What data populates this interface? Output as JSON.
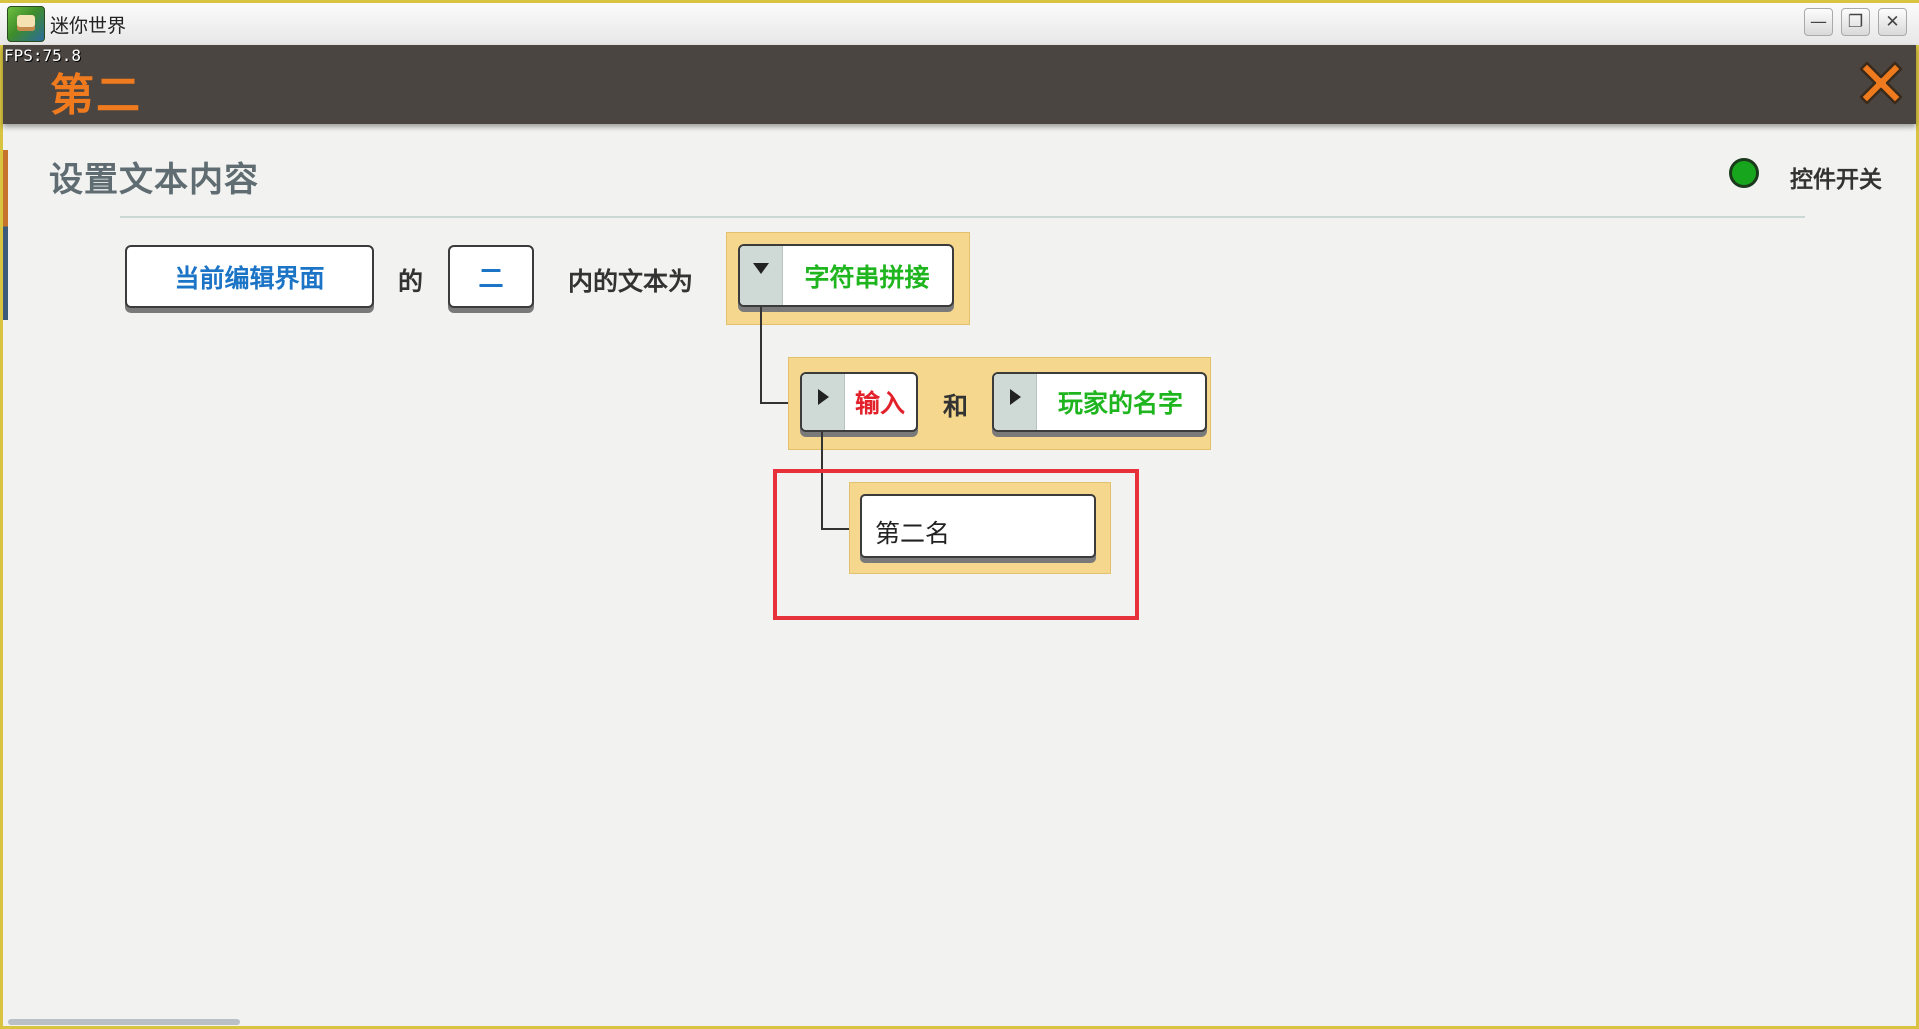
{
  "window": {
    "title": "迷你世界",
    "minimize_glyph": "—",
    "maximize_glyph": "❐",
    "close_glyph": "✕"
  },
  "fps": "FPS:75.8",
  "header": {
    "title": "第二"
  },
  "panel": {
    "heading": "设置文本内容",
    "toggle_label": "控件开关"
  },
  "colors": {
    "accent_orange": "#f07a1e",
    "toggle_green": "#18a51e",
    "highlight_red": "#e6323a",
    "block_yellow": "#f5d78d",
    "text_blue": "#1b74c6",
    "text_green": "#1fb51f",
    "text_red": "#e3212b"
  },
  "blocks": {
    "ui_target": "当前编辑界面",
    "of_word": "的",
    "element_name": "二",
    "text_is": "内的文本为",
    "concat_label": "字符串拼接",
    "and_word": "和",
    "input_label": "输入",
    "player_name_label": "玩家的名字",
    "text_value": "第二名"
  },
  "icons": {
    "dropdown": "caret-down-icon",
    "expand": "caret-right-icon",
    "close": "close-x-icon"
  }
}
